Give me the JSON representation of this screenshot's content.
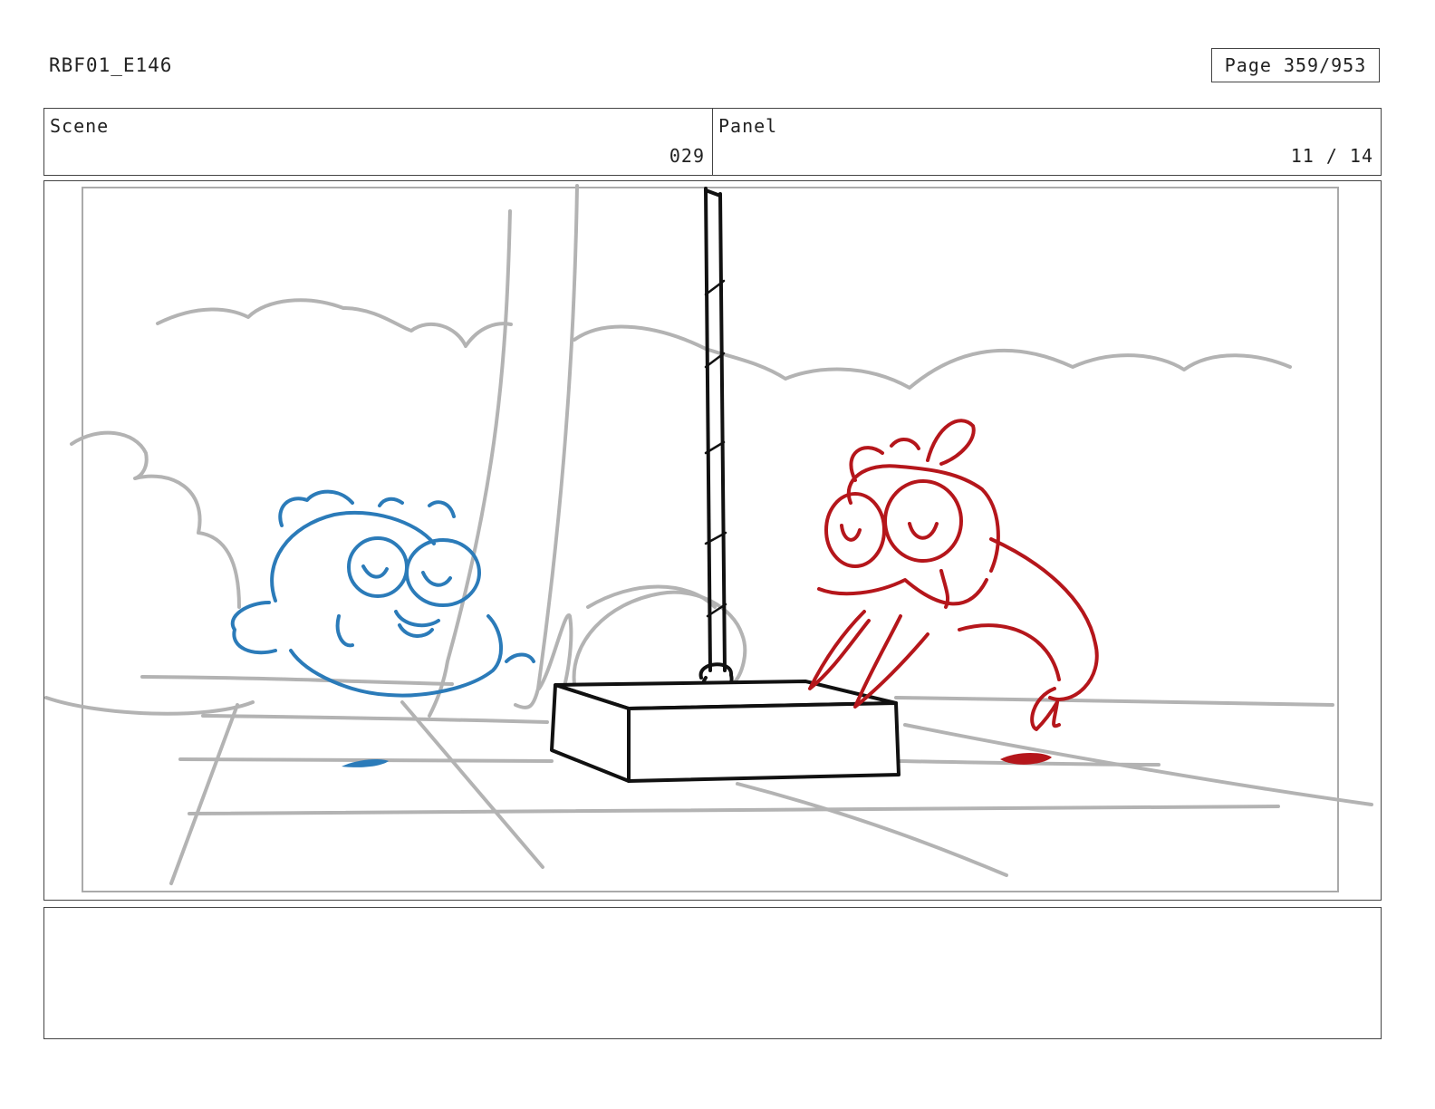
{
  "document": {
    "production_id": "RBF01_E146",
    "page_label": "Page 359/953"
  },
  "header": {
    "scene_label": "Scene",
    "scene_number": "029",
    "panel_label": "Panel",
    "panel_number": "11 / 14"
  },
  "colors": {
    "character_left": "#2b7bb9",
    "character_right": "#b5161b",
    "background_sketch": "#b3b3b3",
    "props": "#111111"
  },
  "notes": {
    "text": ""
  }
}
